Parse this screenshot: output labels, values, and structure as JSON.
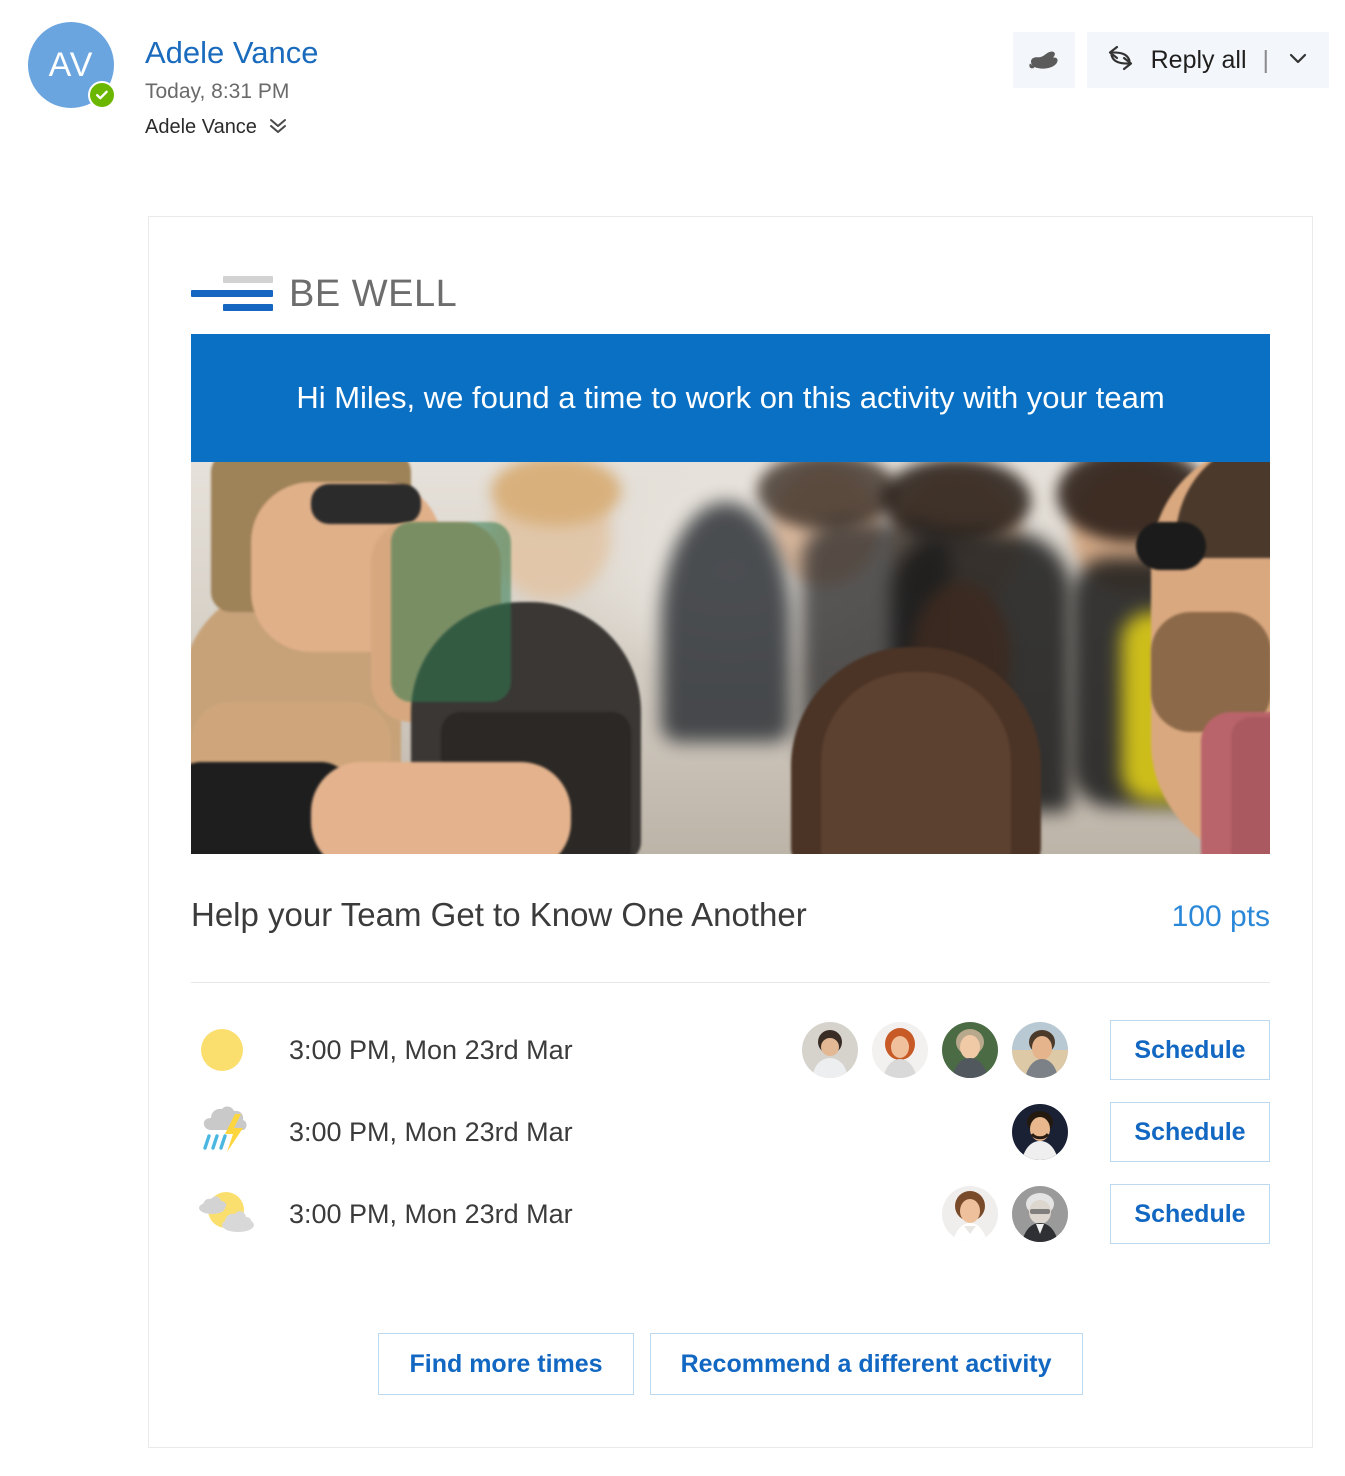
{
  "header": {
    "avatar_initials": "AV",
    "avatar_color": "#6ba5e0",
    "presence_color": "#6bb700",
    "presence_icon": "available-check-icon",
    "sender_name": "Adele Vance",
    "timestamp": "Today, 8:31 PM",
    "recipient": "Adele Vance",
    "expand_icon": "chevron-double-down-icon",
    "like_icon": "thumbs-up-icon",
    "reply_all_label": "Reply all",
    "reply_icon": "reply-all-icon",
    "reply_separator": "|",
    "reply_dropdown_icon": "chevron-down-icon"
  },
  "card": {
    "logo_text": "BE WELL",
    "logo_icon": "be-well-bars-logo",
    "banner_text": "Hi Miles, we found a time to work on this activity with your team",
    "banner_color": "#0a70c4",
    "hero_alt": "group-of-people-huddling-photo",
    "activity_title": "Help your Team Get to Know One Another",
    "points": "100 pts",
    "points_color": "#2b88d8",
    "slots": [
      {
        "weather_icon": "sunny-icon",
        "time": "3:00 PM, Mon 23rd Mar",
        "attendee_count": 4,
        "attendees": [
          "attendee-1",
          "attendee-2",
          "attendee-3",
          "attendee-4"
        ],
        "button_label": "Schedule"
      },
      {
        "weather_icon": "thunderstorm-icon",
        "time": "3:00 PM, Mon 23rd Mar",
        "attendee_count": 1,
        "attendees": [
          "attendee-5"
        ],
        "button_label": "Schedule"
      },
      {
        "weather_icon": "partly-cloudy-icon",
        "time": "3:00 PM, Mon 23rd Mar",
        "attendee_count": 2,
        "attendees": [
          "attendee-6",
          "attendee-7"
        ],
        "button_label": "Schedule"
      }
    ],
    "find_more_times_label": "Find more times",
    "recommend_activity_label": "Recommend a different activity"
  }
}
